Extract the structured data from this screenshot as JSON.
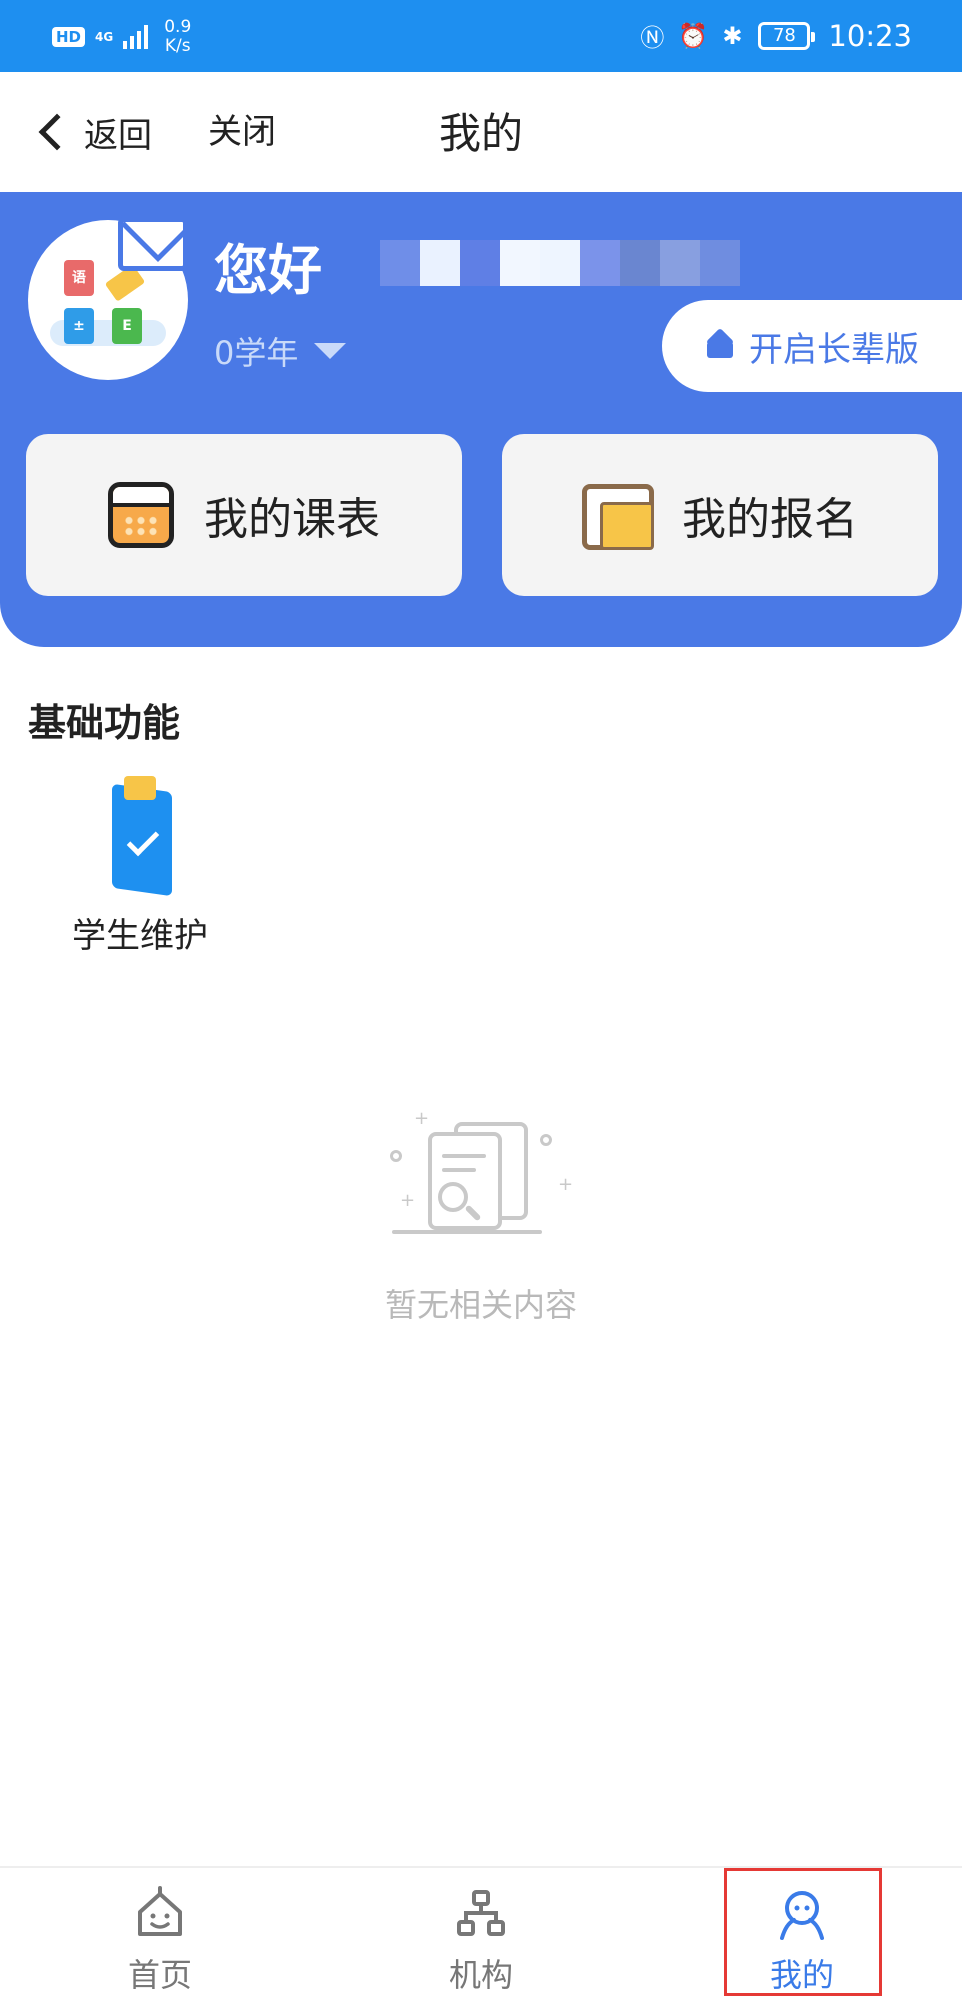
{
  "status_bar": {
    "hd": "HD",
    "network_type": "4G",
    "speed_value": "0.9",
    "speed_unit": "K/s",
    "battery": "78",
    "time": "10:23"
  },
  "nav": {
    "back_label": "返回",
    "close_label": "关闭",
    "title": "我的"
  },
  "profile": {
    "greeting": "您好",
    "grade": "0学年",
    "elder_mode_label": "开启长辈版",
    "avatar_books": [
      "语",
      "±",
      "E"
    ]
  },
  "cards": [
    {
      "label": "我的课表",
      "icon": "calendar-icon"
    },
    {
      "label": "我的报名",
      "icon": "folder-icon"
    }
  ],
  "basic_functions": {
    "title": "基础功能",
    "items": [
      {
        "label": "学生维护",
        "icon": "clipboard-check-icon"
      }
    ]
  },
  "empty_state": {
    "text": "暂无相关内容",
    "icon": "empty-document-search-icon"
  },
  "tab_bar": {
    "tabs": [
      {
        "label": "首页",
        "icon": "home-icon"
      },
      {
        "label": "机构",
        "icon": "org-chart-icon"
      },
      {
        "label": "我的",
        "icon": "person-icon"
      }
    ],
    "active_index": 2
  },
  "colors": {
    "status_bar": "#1e8ff0",
    "header": "#4a79e6",
    "active_tab": "#3a7be8",
    "highlight_box": "#e53935",
    "empty_text": "#b9b9b9"
  }
}
